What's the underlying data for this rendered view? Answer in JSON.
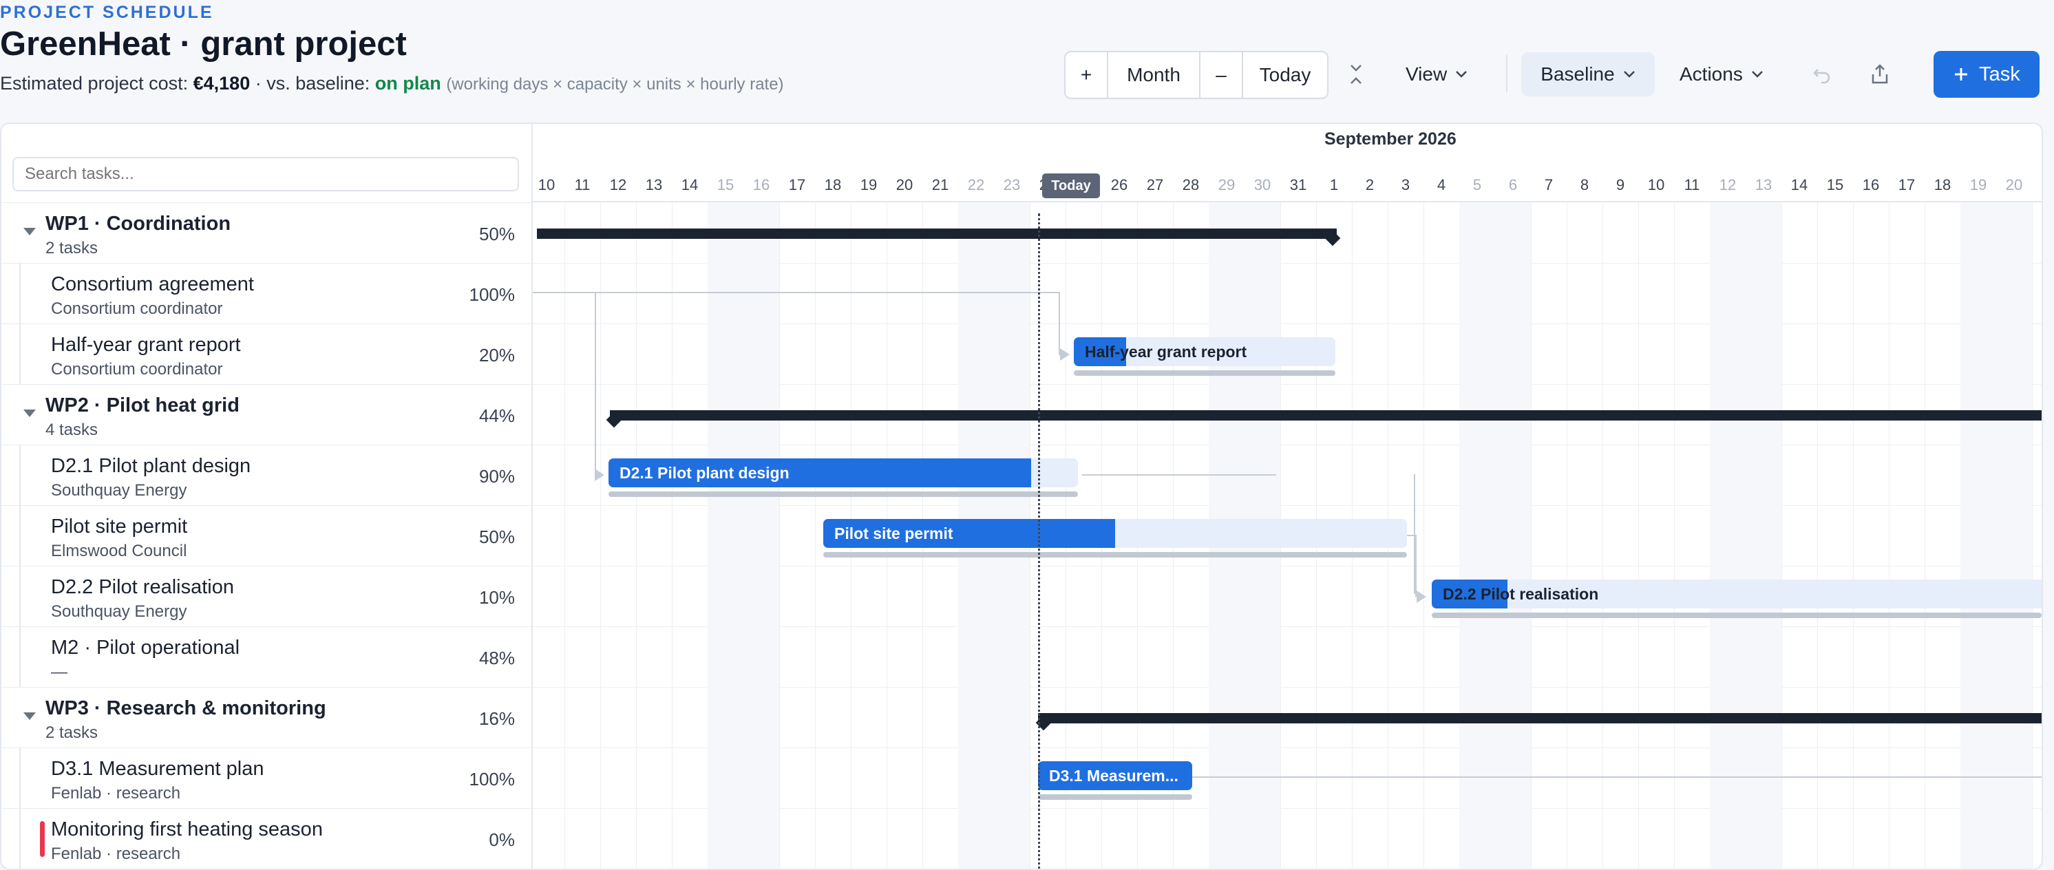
{
  "header": {
    "eyebrow": "PROJECT SCHEDULE",
    "title": "GreenHeat · grant project",
    "cost_prefix": "Estimated project cost: ",
    "cost_value": "€4,180",
    "baseline_prefix": " · vs. baseline: ",
    "baseline_status": "on plan",
    "formula_hint": "(working days × capacity × units × hourly rate)"
  },
  "toolbar": {
    "zoom_in": "+",
    "scale": "Month",
    "zoom_out": "–",
    "today": "Today",
    "view": "View",
    "baseline": "Baseline",
    "actions": "Actions",
    "task": "Task"
  },
  "search": {
    "placeholder": "Search tasks..."
  },
  "timeline": {
    "month": "September 2026",
    "today_label": "Today",
    "days": [
      "10",
      "11",
      "12",
      "13",
      "14",
      "15",
      "16",
      "17",
      "18",
      "19",
      "20",
      "21",
      "22",
      "23",
      "24",
      "25",
      "26",
      "27",
      "28",
      "29",
      "30",
      "31",
      "1",
      "2",
      "3",
      "4",
      "5",
      "6",
      "7",
      "8",
      "9",
      "10",
      "11",
      "12",
      "13",
      "14",
      "15",
      "16",
      "17",
      "18",
      "19",
      "20",
      "21"
    ]
  },
  "rows": [
    {
      "type": "group",
      "name": "WP1 · Coordination",
      "sub": "2 tasks",
      "pct": "50%"
    },
    {
      "type": "task",
      "name": "Consortium agreement",
      "sub": "Consortium coordinator",
      "pct": "100%"
    },
    {
      "type": "task",
      "name": "Half-year grant report",
      "sub": "Consortium coordinator",
      "pct": "20%",
      "bar": "Half-year grant report"
    },
    {
      "type": "group",
      "name": "WP2 · Pilot heat grid",
      "sub": "4 tasks",
      "pct": "44%"
    },
    {
      "type": "task",
      "name": "D2.1 Pilot plant design",
      "sub": "Southquay Energy",
      "pct": "90%",
      "bar": "D2.1 Pilot plant design"
    },
    {
      "type": "task",
      "name": "Pilot site permit",
      "sub": "Elmswood Council",
      "pct": "50%",
      "bar": "Pilot site permit"
    },
    {
      "type": "task",
      "name": "D2.2 Pilot realisation",
      "sub": "Southquay Energy",
      "pct": "10%",
      "bar": "D2.2 Pilot realisation"
    },
    {
      "type": "task",
      "name": "M2 · Pilot operational",
      "sub": "—",
      "pct": "48%"
    },
    {
      "type": "group",
      "name": "WP3 · Research & monitoring",
      "sub": "2 tasks",
      "pct": "16%"
    },
    {
      "type": "task",
      "name": "D3.1 Measurement plan",
      "sub": "Fenlab · research",
      "pct": "100%",
      "bar": "D3.1 Measurem..."
    },
    {
      "type": "task",
      "name": "Monitoring first heating season",
      "sub": "Fenlab · research",
      "pct": "0%"
    }
  ],
  "colors": {
    "accent": "#1f6fe0",
    "on_plan": "#11884a",
    "flag": "#e8384f",
    "summary": "#1c2330"
  }
}
